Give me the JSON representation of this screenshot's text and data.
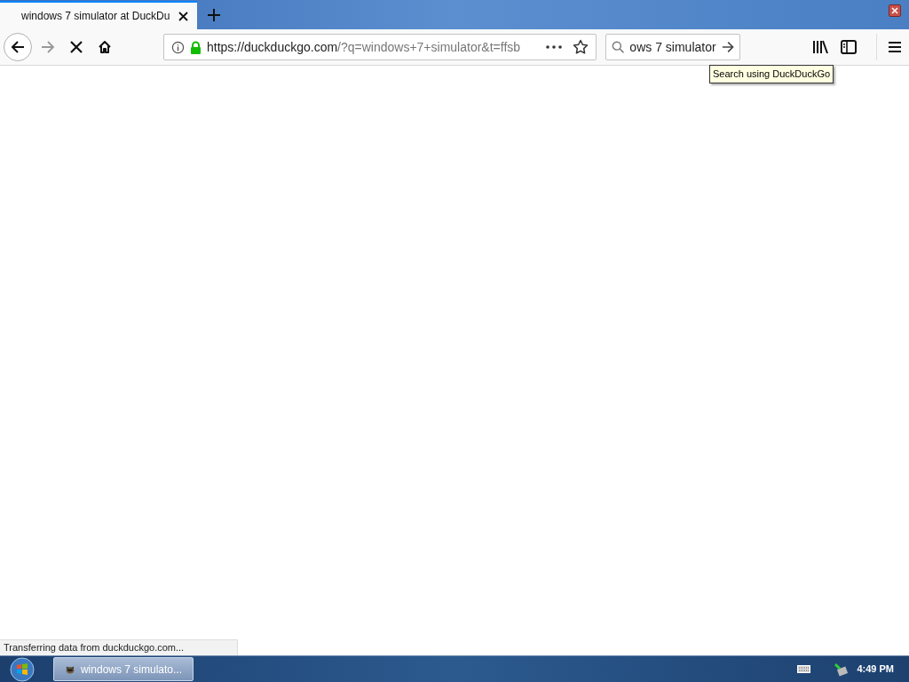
{
  "tabs": [
    {
      "title": "windows 7 simulator at DuckDu",
      "selected": true
    }
  ],
  "toolbar": {
    "back_disabled": false,
    "forward_disabled": true,
    "loading": true
  },
  "url": {
    "host": "https://duckduckgo.com",
    "path": "/?q=windows+7+simulator&t=ffsb"
  },
  "search": {
    "value": "ows 7 simulator"
  },
  "tooltip": "Search using DuckDuckGo",
  "status_bar": "Transferring data from duckduckgo.com...",
  "taskbar": {
    "buttons": [
      {
        "label": "windows 7 simulato...",
        "selected": true
      }
    ],
    "clock": "4:49 PM"
  }
}
